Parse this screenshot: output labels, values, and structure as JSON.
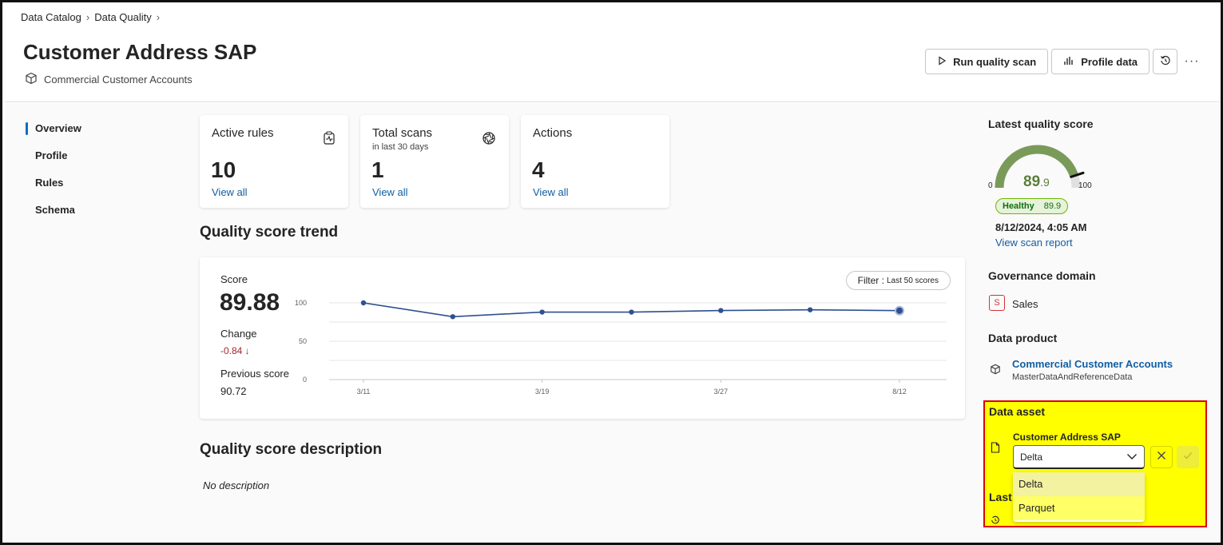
{
  "breadcrumb": [
    "Data Catalog",
    "Data Quality"
  ],
  "page": {
    "title": "Customer Address SAP",
    "subtitle": "Commercial Customer Accounts"
  },
  "actions": {
    "run_scan": "Run quality scan",
    "profile": "Profile data"
  },
  "nav": [
    "Overview",
    "Profile",
    "Rules",
    "Schema"
  ],
  "stats": [
    {
      "title": "Active rules",
      "sub": "",
      "value": "10",
      "link": "View all"
    },
    {
      "title": "Total scans",
      "sub": "in last 30 days",
      "value": "1",
      "link": "View all"
    },
    {
      "title": "Actions",
      "sub": "",
      "value": "4",
      "link": "View all"
    }
  ],
  "trend": {
    "section_title": "Quality score trend",
    "score_label": "Score",
    "score_value": "89.88",
    "change_label": "Change",
    "change_value": "-0.84 ↓",
    "prev_label": "Previous score",
    "prev_value": "90.72",
    "filter_label": "Filter :",
    "filter_value": "Last 50 scores"
  },
  "chart_data": {
    "type": "line",
    "x": [
      "3/11",
      "",
      "3/19",
      "",
      "3/27",
      "",
      "8/12"
    ],
    "tick_labels": [
      "3/11",
      "3/19",
      "3/27",
      "8/12"
    ],
    "series": [
      {
        "values": [
          100,
          82,
          88,
          88,
          90,
          91,
          89.88
        ]
      }
    ],
    "ylim": [
      0,
      100
    ],
    "yticks": [
      0,
      50,
      100
    ],
    "grid": true,
    "color": "#2f4f8f"
  },
  "description": {
    "title": "Quality score description",
    "text": "No description"
  },
  "latest": {
    "title": "Latest quality score",
    "score": "89.9",
    "score_main": "89",
    "score_dec": ".9",
    "min": "0",
    "max": "100",
    "gauge_fraction": 0.899,
    "status": "Healthy",
    "status_score": "89.9",
    "date": "8/12/2024, 4:05 AM",
    "report_link": "View scan report",
    "color": "#7a9a5a"
  },
  "governance": {
    "title": "Governance domain",
    "badge": "S",
    "name": "Sales"
  },
  "product": {
    "title": "Data product",
    "name": "Commercial Customer Accounts",
    "sub": "MasterDataAndReferenceData"
  },
  "asset": {
    "title": "Data asset",
    "name": "Customer Address SAP",
    "selected": "Delta",
    "options": [
      "Delta",
      "Parquet"
    ]
  },
  "last": {
    "title": "Last"
  }
}
